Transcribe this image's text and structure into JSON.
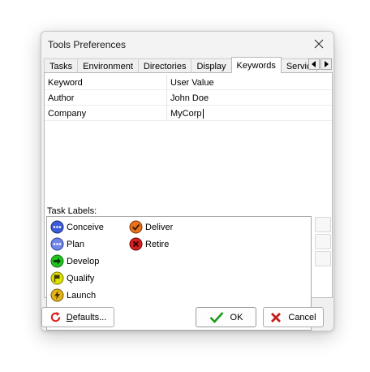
{
  "window": {
    "title": "Tools Preferences"
  },
  "tabs": [
    {
      "label": "Tasks"
    },
    {
      "label": "Environment"
    },
    {
      "label": "Directories"
    },
    {
      "label": "Display"
    },
    {
      "label": "Keywords"
    },
    {
      "label": "Services"
    }
  ],
  "active_tab": "Keywords",
  "keywords": {
    "headers": [
      "Keyword",
      "User Value"
    ],
    "rows": [
      {
        "keyword": "Author",
        "value": "John Doe"
      },
      {
        "keyword": "Company",
        "value": "MyCorp"
      }
    ]
  },
  "task_labels": {
    "title": "Task Labels:",
    "items": [
      {
        "label": "Conceive",
        "icon": "dots-icon",
        "color": "#3d5bd6"
      },
      {
        "label": "Plan",
        "icon": "dots-icon",
        "color": "#6f86e8"
      },
      {
        "label": "Develop",
        "icon": "arrow-icon",
        "color": "#22c21f"
      },
      {
        "label": "Qualify",
        "icon": "flag-icon",
        "color": "#e0e000"
      },
      {
        "label": "Launch",
        "icon": "lightning-icon",
        "color": "#e3b318"
      },
      {
        "label": "Deliver",
        "icon": "check-icon",
        "color": "#e8731c"
      },
      {
        "label": "Retire",
        "icon": "x-icon",
        "color": "#d42020"
      }
    ]
  },
  "buttons": {
    "defaults": {
      "label": "Defaults...",
      "mnemonic": "D",
      "rest": "efaults..."
    },
    "ok": {
      "label": "OK"
    },
    "cancel": {
      "label": "Cancel"
    }
  }
}
